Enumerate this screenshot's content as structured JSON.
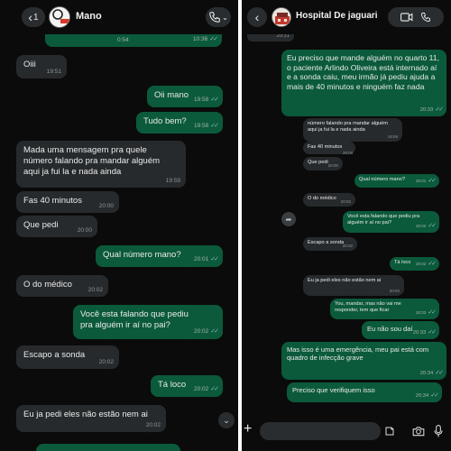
{
  "left_chat": {
    "back_count": "1",
    "avatar_text": "R COR",
    "contact_name": "Mano",
    "top_partial": {
      "time1": "0:54",
      "time2": "10:36"
    },
    "messages": [
      {
        "text": "Oiii",
        "time": "19:51",
        "dir": "in"
      },
      {
        "text": "Oii mano",
        "time": "19:58",
        "dir": "out"
      },
      {
        "text": "Tudo bem?",
        "time": "19:58",
        "dir": "out"
      },
      {
        "text": "Mada uma mensagem pra quele número falando pra mandar alguém aqui ja fui la e nada ainda",
        "time": "19:59",
        "dir": "in"
      },
      {
        "text": "Fas 40 minutos",
        "time": "20:00",
        "dir": "in"
      },
      {
        "text": "Que  pedi",
        "time": "20:00",
        "dir": "in"
      },
      {
        "text": "Qual número mano?",
        "time": "20:01",
        "dir": "out"
      },
      {
        "text": "O do médico",
        "time": "20:02",
        "dir": "in"
      },
      {
        "text": "Você esta falando que pediu pra alguém ir aí no pai?",
        "time": "20:02",
        "dir": "out"
      },
      {
        "text": "Escapo a sonda",
        "time": "20:02",
        "dir": "in"
      },
      {
        "text": "Tá loco",
        "time": "20:02",
        "dir": "out"
      },
      {
        "text": "Eu ja pedi eles não estão  nem ai",
        "time": "20:02",
        "dir": "in"
      }
    ]
  },
  "right_chat": {
    "contact_name": "Hospital De jaguari",
    "top_time": "20:31",
    "input_placeholder": "",
    "messages": [
      {
        "text": "Eu preciso que mande alguém no quarto 11, o paciente Arlindo Oliveira está internado aí e a sonda caiu, meu irmão já pediu ajuda a mais de 40 minutos e ninguém faz nada",
        "time": "20:33",
        "dir": "out"
      },
      {
        "text": "número falando pra mandar alguém aqui ja fui la e nada ainda",
        "time": "19:59",
        "dir": "in"
      },
      {
        "text": "Fas 40 minutos",
        "time": "20:00",
        "dir": "in"
      },
      {
        "text": "Que  pedi",
        "time": "20:00",
        "dir": "in"
      },
      {
        "text": "Qual número mano?",
        "time": "20:01",
        "dir": "out"
      },
      {
        "text": "O do médico",
        "time": "20:02",
        "dir": "in"
      },
      {
        "text": "Você esta falando que pediu pra alguém ir aí no pai?",
        "time": "20:02",
        "dir": "out"
      },
      {
        "text": "Escapo a sonda",
        "time": "20:02",
        "dir": "in"
      },
      {
        "text": "Tá loco",
        "time": "20:02",
        "dir": "out"
      },
      {
        "text": "Eu ja pedi eles não estão  nem ai",
        "time": "20:02",
        "dir": "in"
      },
      {
        "text": "You, mandar, mas não vai me responder, tem que ficar",
        "time": "20:33",
        "dir": "out"
      },
      {
        "text": "Eu não sou daí",
        "time": "20:33",
        "dir": "out"
      },
      {
        "text": "Mas isso é uma emergência, meu pai está com quadro de infecção grave",
        "time": "20:34",
        "dir": "out"
      },
      {
        "text": "Preciso que verifiquem isso",
        "time": "20:34",
        "dir": "out"
      }
    ]
  },
  "icons": {
    "back": "chevron-left-icon",
    "call": "phone-icon",
    "video": "video-icon",
    "scroll": "chevron-down-icon",
    "forward": "forward-icon",
    "plus": "plus-icon",
    "sticker": "sticker-icon",
    "camera": "camera-icon",
    "mic": "microphone-icon"
  },
  "colors": {
    "background": "#0b0b0b",
    "incoming_bubble": "#262a2c",
    "outgoing_bubble": "#0a5a3b",
    "read_ticks": "#8fb6c8"
  }
}
